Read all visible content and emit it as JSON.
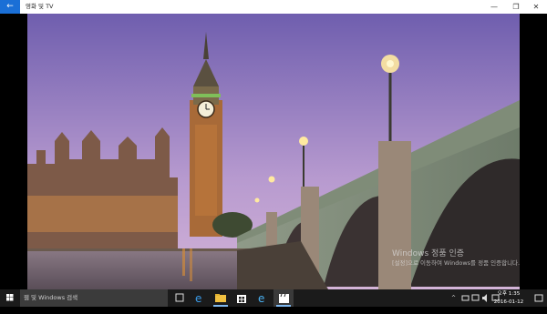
{
  "window": {
    "title": "영화 및 TV",
    "back_icon": "back-arrow-icon",
    "minimize_glyph": "—",
    "maximize_glyph": "❐",
    "close_glyph": "✕"
  },
  "watermark": {
    "title": "Windows 정품 인증",
    "subtitle": "[설정]으로 이동하여 Windows를 정품 인증합니다."
  },
  "taskbar": {
    "search_placeholder": "웹 및 Windows 검색",
    "clock_time": "오후 1:35",
    "clock_date": "2016-01-12",
    "tray_chevron": "^"
  },
  "colors": {
    "accent": "#1a6fd6",
    "taskbar": "#1b1b1b",
    "sky_top": "#7a68b8",
    "sky_bottom": "#c8a6d8"
  }
}
